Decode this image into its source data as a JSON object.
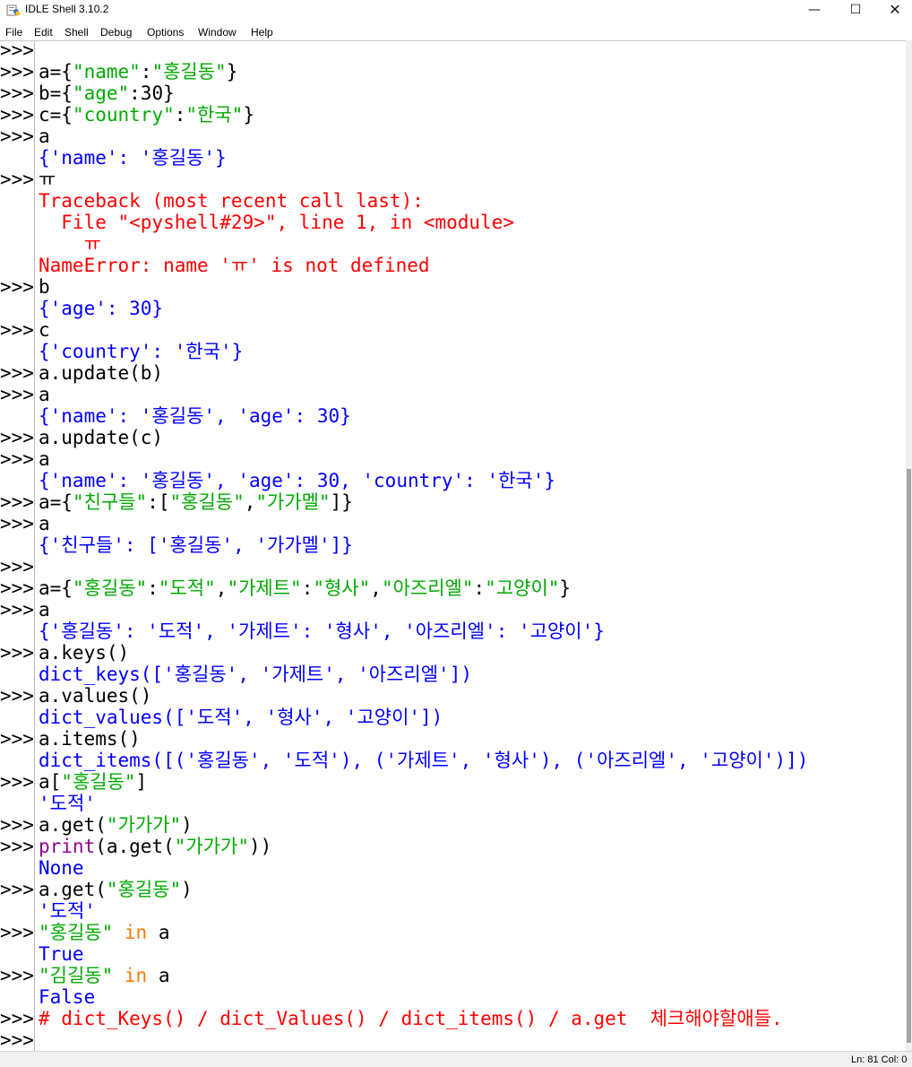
{
  "window": {
    "title": "IDLE Shell 3.10.2",
    "minimize": "—",
    "maximize": "☐",
    "close": "✕"
  },
  "menu": [
    "File",
    "Edit",
    "Shell",
    "Debug",
    "Options",
    "Window",
    "Help"
  ],
  "status": {
    "line_col": "Ln: 81   Col: 0"
  },
  "colors": {
    "string": "#00aa00",
    "output": "#0000ff",
    "error": "#ff0000",
    "keyword": "#ff7700",
    "builtin": "#900090"
  },
  "lines": [
    {
      "p": ">>>",
      "s": []
    },
    {
      "p": ">>>",
      "s": [
        [
          "txt",
          "a={"
        ],
        [
          "str",
          "\"name\""
        ],
        [
          "txt",
          ":"
        ],
        [
          "str",
          "\"홍길동\""
        ],
        [
          "txt",
          "}"
        ]
      ]
    },
    {
      "p": ">>>",
      "s": [
        [
          "txt",
          "b={"
        ],
        [
          "str",
          "\"age\""
        ],
        [
          "txt",
          ":30}"
        ]
      ]
    },
    {
      "p": ">>>",
      "s": [
        [
          "txt",
          "c={"
        ],
        [
          "str",
          "\"country\""
        ],
        [
          "txt",
          ":"
        ],
        [
          "str",
          "\"한국\""
        ],
        [
          "txt",
          "}"
        ]
      ]
    },
    {
      "p": ">>>",
      "s": [
        [
          "txt",
          "a"
        ]
      ]
    },
    {
      "p": "",
      "s": [
        [
          "out",
          "{'name': '홍길동'}"
        ]
      ]
    },
    {
      "p": ">>>",
      "s": [
        [
          "txt",
          "ㅠ"
        ]
      ]
    },
    {
      "p": "",
      "s": [
        [
          "err",
          "Traceback (most recent call last):"
        ]
      ]
    },
    {
      "p": "",
      "s": [
        [
          "err",
          "  File \"<pyshell#29>\", line 1, in <module>"
        ]
      ]
    },
    {
      "p": "",
      "s": [
        [
          "err",
          "    ㅠ"
        ]
      ]
    },
    {
      "p": "",
      "s": [
        [
          "err",
          "NameError: name 'ㅠ' is not defined"
        ]
      ]
    },
    {
      "p": ">>>",
      "s": [
        [
          "txt",
          "b"
        ]
      ]
    },
    {
      "p": "",
      "s": [
        [
          "out",
          "{'age': 30}"
        ]
      ]
    },
    {
      "p": ">>>",
      "s": [
        [
          "txt",
          "c"
        ]
      ]
    },
    {
      "p": "",
      "s": [
        [
          "out",
          "{'country': '한국'}"
        ]
      ]
    },
    {
      "p": ">>>",
      "s": [
        [
          "txt",
          "a.update(b)"
        ]
      ]
    },
    {
      "p": ">>>",
      "s": [
        [
          "txt",
          "a"
        ]
      ]
    },
    {
      "p": "",
      "s": [
        [
          "out",
          "{'name': '홍길동', 'age': 30}"
        ]
      ]
    },
    {
      "p": ">>>",
      "s": [
        [
          "txt",
          "a.update(c)"
        ]
      ]
    },
    {
      "p": ">>>",
      "s": [
        [
          "txt",
          "a"
        ]
      ]
    },
    {
      "p": "",
      "s": [
        [
          "out",
          "{'name': '홍길동', 'age': 30, 'country': '한국'}"
        ]
      ]
    },
    {
      "p": ">>>",
      "s": [
        [
          "txt",
          "a={"
        ],
        [
          "str",
          "\"친구들\""
        ],
        [
          "txt",
          ":["
        ],
        [
          "str",
          "\"홍길동\""
        ],
        [
          "txt",
          ","
        ],
        [
          "str",
          "\"가가멜\""
        ],
        [
          "txt",
          "]}"
        ]
      ]
    },
    {
      "p": ">>>",
      "s": [
        [
          "txt",
          "a"
        ]
      ]
    },
    {
      "p": "",
      "s": [
        [
          "out",
          "{'친구들': ['홍길동', '가가멜']}"
        ]
      ]
    },
    {
      "p": ">>>",
      "s": []
    },
    {
      "p": ">>>",
      "s": [
        [
          "txt",
          "a={"
        ],
        [
          "str",
          "\"홍길동\""
        ],
        [
          "txt",
          ":"
        ],
        [
          "str",
          "\"도적\""
        ],
        [
          "txt",
          ","
        ],
        [
          "str",
          "\"가제트\""
        ],
        [
          "txt",
          ":"
        ],
        [
          "str",
          "\"형사\""
        ],
        [
          "txt",
          ","
        ],
        [
          "str",
          "\"아즈리엘\""
        ],
        [
          "txt",
          ":"
        ],
        [
          "str",
          "\"고양이\""
        ],
        [
          "txt",
          "}"
        ]
      ]
    },
    {
      "p": ">>>",
      "s": [
        [
          "txt",
          "a"
        ]
      ]
    },
    {
      "p": "",
      "s": [
        [
          "out",
          "{'홍길동': '도적', '가제트': '형사', '아즈리엘': '고양이'}"
        ]
      ]
    },
    {
      "p": ">>>",
      "s": [
        [
          "txt",
          "a.keys()"
        ]
      ]
    },
    {
      "p": "",
      "s": [
        [
          "out",
          "dict_keys(['홍길동', '가제트', '아즈리엘'])"
        ]
      ]
    },
    {
      "p": ">>>",
      "s": [
        [
          "txt",
          "a.values()"
        ]
      ]
    },
    {
      "p": "",
      "s": [
        [
          "out",
          "dict_values(['도적', '형사', '고양이'])"
        ]
      ]
    },
    {
      "p": ">>>",
      "s": [
        [
          "txt",
          "a.items()"
        ]
      ]
    },
    {
      "p": "",
      "s": [
        [
          "out",
          "dict_items([('홍길동', '도적'), ('가제트', '형사'), ('아즈리엘', '고양이')])"
        ]
      ]
    },
    {
      "p": ">>>",
      "s": [
        [
          "txt",
          "a["
        ],
        [
          "str",
          "\"홍길동\""
        ],
        [
          "txt",
          "]"
        ]
      ]
    },
    {
      "p": "",
      "s": [
        [
          "out",
          "'도적'"
        ]
      ]
    },
    {
      "p": ">>>",
      "s": [
        [
          "txt",
          "a.get("
        ],
        [
          "str",
          "\"가가가\""
        ],
        [
          "txt",
          ")"
        ]
      ]
    },
    {
      "p": ">>>",
      "s": [
        [
          "bi",
          "print"
        ],
        [
          "txt",
          "(a.get("
        ],
        [
          "str",
          "\"가가가\""
        ],
        [
          "txt",
          "))"
        ]
      ]
    },
    {
      "p": "",
      "s": [
        [
          "out",
          "None"
        ]
      ]
    },
    {
      "p": ">>>",
      "s": [
        [
          "txt",
          "a.get("
        ],
        [
          "str",
          "\"홍길동\""
        ],
        [
          "txt",
          ")"
        ]
      ]
    },
    {
      "p": "",
      "s": [
        [
          "out",
          "'도적'"
        ]
      ]
    },
    {
      "p": ">>>",
      "s": [
        [
          "str",
          "\"홍길동\""
        ],
        [
          "txt",
          " "
        ],
        [
          "kw",
          "in"
        ],
        [
          "txt",
          " a"
        ]
      ]
    },
    {
      "p": "",
      "s": [
        [
          "out",
          "True"
        ]
      ]
    },
    {
      "p": ">>>",
      "s": [
        [
          "str",
          "\"김길동\""
        ],
        [
          "txt",
          " "
        ],
        [
          "kw",
          "in"
        ],
        [
          "txt",
          " a"
        ]
      ]
    },
    {
      "p": "",
      "s": [
        [
          "out",
          "False"
        ]
      ]
    },
    {
      "p": ">>>",
      "s": [
        [
          "err",
          "# dict_Keys() / dict_Values() / dict_items() / a.get  체크해야할애들."
        ]
      ]
    },
    {
      "p": ">>>",
      "s": []
    }
  ]
}
